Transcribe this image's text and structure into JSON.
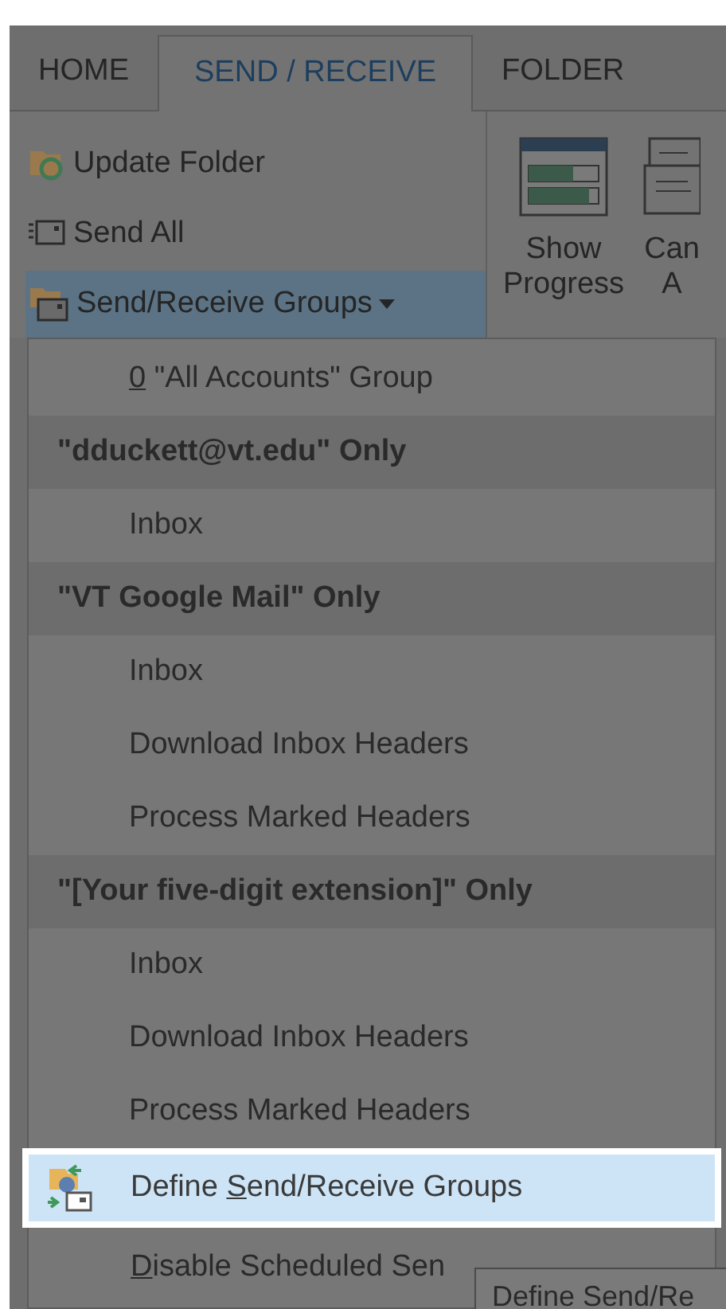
{
  "ribbon": {
    "tabs": [
      {
        "label": "HOME",
        "selected": false
      },
      {
        "label": "SEND / RECEIVE",
        "selected": true
      },
      {
        "label": "FOLDER",
        "selected": false
      }
    ],
    "commands": [
      {
        "label": "Update Folder",
        "active": false,
        "dropdown": false
      },
      {
        "label": "Send All",
        "active": false,
        "dropdown": false
      },
      {
        "label": "Send/Receive Groups",
        "active": true,
        "dropdown": true
      }
    ],
    "large_buttons": [
      {
        "lines": [
          "Show",
          "Progress"
        ]
      },
      {
        "lines": [
          "Can",
          "A"
        ]
      }
    ]
  },
  "menu": {
    "items": [
      {
        "kind": "item",
        "key": "0",
        "after": " \"All Accounts\" Group"
      },
      {
        "kind": "header",
        "label": "\"dduckett@vt.edu\" Only"
      },
      {
        "kind": "item",
        "label": "Inbox"
      },
      {
        "kind": "header",
        "label": "\"VT Google Mail\" Only"
      },
      {
        "kind": "item",
        "label": "Inbox"
      },
      {
        "kind": "item",
        "label": "Download Inbox Headers"
      },
      {
        "kind": "item",
        "label": "Process Marked Headers"
      },
      {
        "kind": "header",
        "label": "\"[Your five-digit extension]\" Only"
      },
      {
        "kind": "item",
        "label": "Inbox"
      },
      {
        "kind": "item",
        "label": "Download Inbox Headers"
      },
      {
        "kind": "item",
        "label": "Process Marked Headers"
      },
      {
        "kind": "icon_command",
        "before": "Define ",
        "key": "S",
        "after": "end/Receive Groups",
        "highlighted": true
      },
      {
        "kind": "command",
        "key": "D",
        "after": "isable Scheduled Sen",
        "highlighted": false
      }
    ]
  },
  "tooltip": {
    "text": "Define Send/Re"
  }
}
